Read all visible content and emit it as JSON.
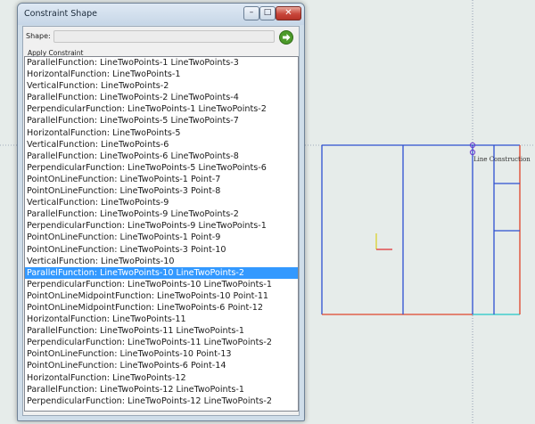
{
  "window": {
    "title": "Constraint Shape",
    "minimize_glyph": "–",
    "maximize_glyph": "□",
    "close_glyph": "✕"
  },
  "shape": {
    "label": "Shape:",
    "value": ""
  },
  "apply_icon": "green-arrow-right-icon",
  "section_label": "Apply Constraint",
  "constraints": [
    "ParallelFunction: LineTwoPoints-1 LineTwoPoints-3",
    "HorizontalFunction: LineTwoPoints-1",
    "VerticalFunction: LineTwoPoints-2",
    "ParallelFunction: LineTwoPoints-2 LineTwoPoints-4",
    "PerpendicularFunction: LineTwoPoints-1 LineTwoPoints-2",
    "ParallelFunction: LineTwoPoints-5 LineTwoPoints-7",
    "HorizontalFunction: LineTwoPoints-5",
    "VerticalFunction: LineTwoPoints-6",
    "ParallelFunction: LineTwoPoints-6 LineTwoPoints-8",
    "PerpendicularFunction: LineTwoPoints-5 LineTwoPoints-6",
    "PointOnLineFunction: LineTwoPoints-1 Point-7",
    "PointOnLineFunction: LineTwoPoints-3 Point-8",
    "VerticalFunction: LineTwoPoints-9",
    "ParallelFunction: LineTwoPoints-9 LineTwoPoints-2",
    "PerpendicularFunction: LineTwoPoints-9 LineTwoPoints-1",
    "PointOnLineFunction: LineTwoPoints-1 Point-9",
    "PointOnLineFunction: LineTwoPoints-3 Point-10",
    "VerticalFunction: LineTwoPoints-10",
    "ParallelFunction: LineTwoPoints-10 LineTwoPoints-2",
    "PerpendicularFunction: LineTwoPoints-10 LineTwoPoints-1",
    "PointOnLineMidpointFunction: LineTwoPoints-10 Point-11",
    "PointOnLineMidpointFunction: LineTwoPoints-6 Point-12",
    "HorizontalFunction: LineTwoPoints-11",
    "ParallelFunction: LineTwoPoints-11 LineTwoPoints-1",
    "PerpendicularFunction: LineTwoPoints-11 LineTwoPoints-2",
    "PointOnLineFunction: LineTwoPoints-10 Point-13",
    "PointOnLineFunction: LineTwoPoints-6 Point-14",
    "HorizontalFunction: LineTwoPoints-12",
    "ParallelFunction: LineTwoPoints-12 LineTwoPoints-1",
    "PerpendicularFunction: LineTwoPoints-12 LineTwoPoints-2"
  ],
  "selected_index": 18,
  "canvas": {
    "label": "Line Construction",
    "colors": {
      "primary_line": "#2e4fd1",
      "secondary_line": "#e0442a",
      "accent_line": "#22c7c7",
      "axis_x": "#e03030",
      "axis_y": "#d8d020",
      "selection_point": "#6a3ad0"
    }
  },
  "colors": {
    "selection": "#3399ff",
    "close_button": "#c8463a"
  }
}
